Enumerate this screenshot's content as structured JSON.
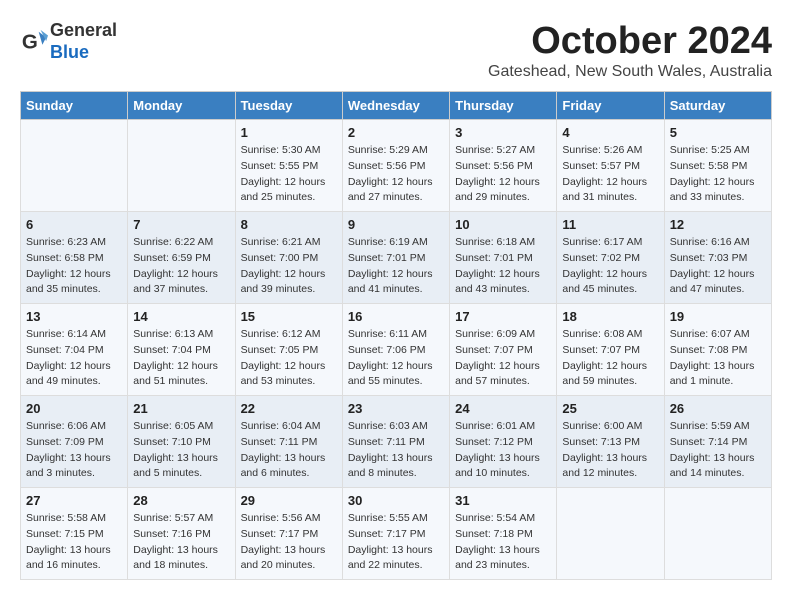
{
  "header": {
    "logo_line1": "General",
    "logo_line2": "Blue",
    "month_title": "October 2024",
    "subtitle": "Gateshead, New South Wales, Australia"
  },
  "days_of_week": [
    "Sunday",
    "Monday",
    "Tuesday",
    "Wednesday",
    "Thursday",
    "Friday",
    "Saturday"
  ],
  "weeks": [
    [
      {
        "day": "",
        "info": ""
      },
      {
        "day": "",
        "info": ""
      },
      {
        "day": "1",
        "info": "Sunrise: 5:30 AM\nSunset: 5:55 PM\nDaylight: 12 hours and 25 minutes."
      },
      {
        "day": "2",
        "info": "Sunrise: 5:29 AM\nSunset: 5:56 PM\nDaylight: 12 hours and 27 minutes."
      },
      {
        "day": "3",
        "info": "Sunrise: 5:27 AM\nSunset: 5:56 PM\nDaylight: 12 hours and 29 minutes."
      },
      {
        "day": "4",
        "info": "Sunrise: 5:26 AM\nSunset: 5:57 PM\nDaylight: 12 hours and 31 minutes."
      },
      {
        "day": "5",
        "info": "Sunrise: 5:25 AM\nSunset: 5:58 PM\nDaylight: 12 hours and 33 minutes."
      }
    ],
    [
      {
        "day": "6",
        "info": "Sunrise: 6:23 AM\nSunset: 6:58 PM\nDaylight: 12 hours and 35 minutes."
      },
      {
        "day": "7",
        "info": "Sunrise: 6:22 AM\nSunset: 6:59 PM\nDaylight: 12 hours and 37 minutes."
      },
      {
        "day": "8",
        "info": "Sunrise: 6:21 AM\nSunset: 7:00 PM\nDaylight: 12 hours and 39 minutes."
      },
      {
        "day": "9",
        "info": "Sunrise: 6:19 AM\nSunset: 7:01 PM\nDaylight: 12 hours and 41 minutes."
      },
      {
        "day": "10",
        "info": "Sunrise: 6:18 AM\nSunset: 7:01 PM\nDaylight: 12 hours and 43 minutes."
      },
      {
        "day": "11",
        "info": "Sunrise: 6:17 AM\nSunset: 7:02 PM\nDaylight: 12 hours and 45 minutes."
      },
      {
        "day": "12",
        "info": "Sunrise: 6:16 AM\nSunset: 7:03 PM\nDaylight: 12 hours and 47 minutes."
      }
    ],
    [
      {
        "day": "13",
        "info": "Sunrise: 6:14 AM\nSunset: 7:04 PM\nDaylight: 12 hours and 49 minutes."
      },
      {
        "day": "14",
        "info": "Sunrise: 6:13 AM\nSunset: 7:04 PM\nDaylight: 12 hours and 51 minutes."
      },
      {
        "day": "15",
        "info": "Sunrise: 6:12 AM\nSunset: 7:05 PM\nDaylight: 12 hours and 53 minutes."
      },
      {
        "day": "16",
        "info": "Sunrise: 6:11 AM\nSunset: 7:06 PM\nDaylight: 12 hours and 55 minutes."
      },
      {
        "day": "17",
        "info": "Sunrise: 6:09 AM\nSunset: 7:07 PM\nDaylight: 12 hours and 57 minutes."
      },
      {
        "day": "18",
        "info": "Sunrise: 6:08 AM\nSunset: 7:07 PM\nDaylight: 12 hours and 59 minutes."
      },
      {
        "day": "19",
        "info": "Sunrise: 6:07 AM\nSunset: 7:08 PM\nDaylight: 13 hours and 1 minute."
      }
    ],
    [
      {
        "day": "20",
        "info": "Sunrise: 6:06 AM\nSunset: 7:09 PM\nDaylight: 13 hours and 3 minutes."
      },
      {
        "day": "21",
        "info": "Sunrise: 6:05 AM\nSunset: 7:10 PM\nDaylight: 13 hours and 5 minutes."
      },
      {
        "day": "22",
        "info": "Sunrise: 6:04 AM\nSunset: 7:11 PM\nDaylight: 13 hours and 6 minutes."
      },
      {
        "day": "23",
        "info": "Sunrise: 6:03 AM\nSunset: 7:11 PM\nDaylight: 13 hours and 8 minutes."
      },
      {
        "day": "24",
        "info": "Sunrise: 6:01 AM\nSunset: 7:12 PM\nDaylight: 13 hours and 10 minutes."
      },
      {
        "day": "25",
        "info": "Sunrise: 6:00 AM\nSunset: 7:13 PM\nDaylight: 13 hours and 12 minutes."
      },
      {
        "day": "26",
        "info": "Sunrise: 5:59 AM\nSunset: 7:14 PM\nDaylight: 13 hours and 14 minutes."
      }
    ],
    [
      {
        "day": "27",
        "info": "Sunrise: 5:58 AM\nSunset: 7:15 PM\nDaylight: 13 hours and 16 minutes."
      },
      {
        "day": "28",
        "info": "Sunrise: 5:57 AM\nSunset: 7:16 PM\nDaylight: 13 hours and 18 minutes."
      },
      {
        "day": "29",
        "info": "Sunrise: 5:56 AM\nSunset: 7:17 PM\nDaylight: 13 hours and 20 minutes."
      },
      {
        "day": "30",
        "info": "Sunrise: 5:55 AM\nSunset: 7:17 PM\nDaylight: 13 hours and 22 minutes."
      },
      {
        "day": "31",
        "info": "Sunrise: 5:54 AM\nSunset: 7:18 PM\nDaylight: 13 hours and 23 minutes."
      },
      {
        "day": "",
        "info": ""
      },
      {
        "day": "",
        "info": ""
      }
    ]
  ]
}
